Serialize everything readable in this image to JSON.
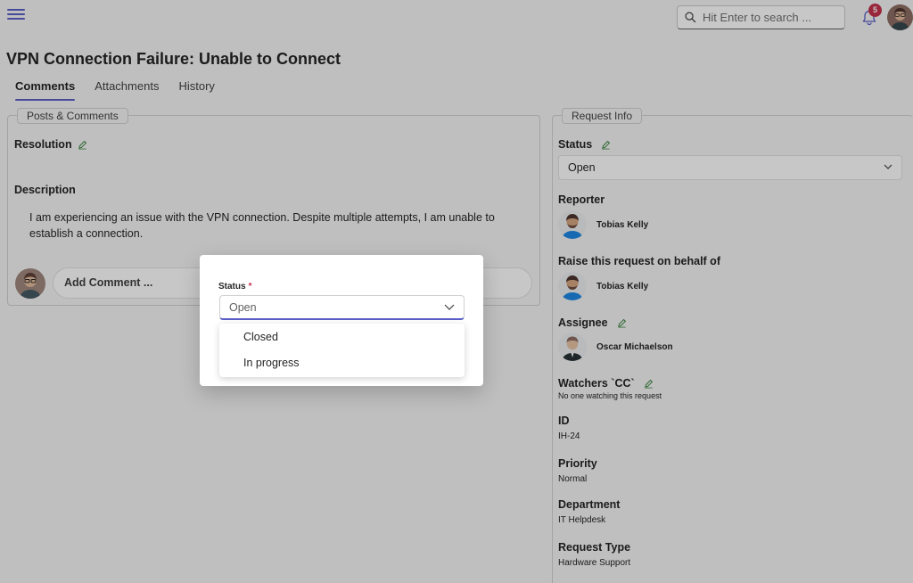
{
  "header": {
    "search_placeholder": "Hit Enter to search ...",
    "notification_count": "5"
  },
  "page": {
    "title": "VPN Connection Failure: Unable to Connect",
    "tabs": [
      {
        "label": "Comments",
        "active": true
      },
      {
        "label": "Attachments",
        "active": false
      },
      {
        "label": "History",
        "active": false
      }
    ]
  },
  "posts": {
    "legend": "Posts & Comments",
    "resolution_label": "Resolution",
    "description_label": "Description",
    "description_text": "I am experiencing an issue with the VPN connection. Despite multiple attempts, I am unable to establish a connection.",
    "add_comment_placeholder": "Add Comment ..."
  },
  "request_info": {
    "legend": "Request Info",
    "status_label": "Status",
    "status_value": "Open",
    "reporter_label": "Reporter",
    "reporter_name": "Tobias Kelly",
    "behalf_label": "Raise this request on behalf of",
    "behalf_name": "Tobias Kelly",
    "assignee_label": "Assignee",
    "assignee_name": "Oscar Michaelson",
    "watchers_label": "Watchers `CC`",
    "watchers_value": "No one watching this request",
    "id_label": "ID",
    "id_value": "IH-24",
    "priority_label": "Priority",
    "priority_value": "Normal",
    "department_label": "Department",
    "department_value": "IT Helpdesk",
    "request_type_label": "Request Type",
    "request_type_value": "Hardware Support"
  },
  "dialog": {
    "status_label": "Status",
    "required_mark": "*",
    "selected_value": "Open",
    "options": [
      "Closed",
      "In progress"
    ]
  },
  "colors": {
    "accent": "#5b5fc7",
    "badge": "#c4314b",
    "edit_icon": "#2e7d32"
  },
  "icons": [
    "hamburger-menu-icon",
    "search-icon",
    "bell-icon",
    "pencil-icon",
    "chevron-down-icon"
  ]
}
